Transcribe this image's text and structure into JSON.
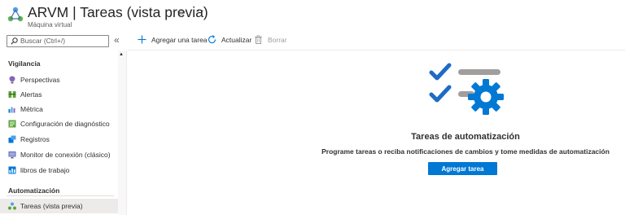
{
  "header": {
    "title": "ARVM | Tareas (vista previa)",
    "subtitle": "Máquina virtual",
    "favorite_icon": "star-icon",
    "more_icon": "ellipsis-icon"
  },
  "sidebar": {
    "search_placeholder": "Buscar (Ctrl+/)",
    "collapse_glyph": "«",
    "sections": [
      {
        "title": "Vigilancia",
        "items": [
          {
            "label": "Perspectivas",
            "icon": "lightbulb-icon"
          },
          {
            "label": "Alertas",
            "icon": "alert-icon"
          },
          {
            "label": "Métrica",
            "icon": "metrics-icon"
          },
          {
            "label": "Configuración de diagnóstico",
            "icon": "diagnostic-settings-icon"
          },
          {
            "label": "Registros",
            "icon": "logs-icon"
          },
          {
            "label": "Monitor de conexión (clásico)",
            "icon": "connection-monitor-icon"
          },
          {
            "label": "libros de trabajo",
            "icon": "workbooks-icon"
          }
        ]
      },
      {
        "title": "Automatización",
        "items": [
          {
            "label": "Tareas (vista previa)",
            "icon": "tasks-icon",
            "selected": true
          }
        ]
      }
    ]
  },
  "toolbar": {
    "add_label": "Agregar una tarea",
    "refresh_label": "Actualizar",
    "delete_label": "Borrar"
  },
  "empty_state": {
    "title": "Tareas de automatización",
    "description": "Programe tareas o reciba notificaciones de cambios y tome medidas de automatización",
    "button_label": "Agregar tarea"
  },
  "colors": {
    "accent": "#0078d4",
    "selected_bg": "#edebe9",
    "gear": "#0078d4",
    "check": "#1f6bc4",
    "bar": "#a19f9d"
  }
}
